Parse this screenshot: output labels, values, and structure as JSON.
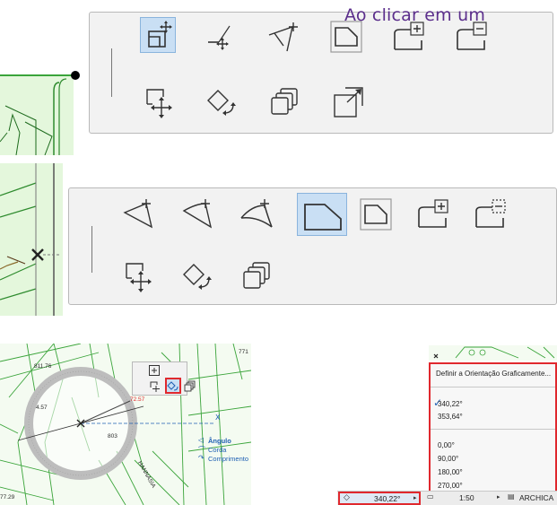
{
  "caption": "Ao clicar em um",
  "toolbar1": {
    "buttons": [
      {
        "name": "offset-edge-icon",
        "selected": true
      },
      {
        "name": "curve-edge-icon"
      },
      {
        "name": "fillet-vertex-icon"
      },
      {
        "name": "polygon-shape-icon"
      },
      {
        "name": "add-to-polygon-icon"
      },
      {
        "name": "subtract-from-polygon-icon"
      },
      {
        "name": "drag-icon"
      },
      {
        "name": "rotate-icon"
      },
      {
        "name": "multiply-icon"
      },
      {
        "name": "resize-icon"
      }
    ]
  },
  "toolbar2": {
    "buttons": [
      {
        "name": "arc-segment-icon"
      },
      {
        "name": "arc-tangent-icon"
      },
      {
        "name": "arc-curve-icon"
      },
      {
        "name": "polygon-shape-icon",
        "selected": true
      },
      {
        "name": "polygon-offset-icon"
      },
      {
        "name": "add-to-polygon-icon"
      },
      {
        "name": "subtract-from-polygon-icon"
      },
      {
        "name": "drag-icon"
      },
      {
        "name": "rotate-icon"
      },
      {
        "name": "multiply-icon"
      }
    ]
  },
  "map": {
    "labels": [
      "811.76",
      "4.57",
      "803",
      "72.57",
      "771",
      "HANNASIA",
      "77.29"
    ],
    "legend": [
      "Ângulo",
      "Corda",
      "Comprimento"
    ]
  },
  "orientation_menu": {
    "header": "Definir a Orientação Graficamente...",
    "checked_item": "340,22°",
    "other_recent": "353,64°",
    "presets": [
      "0,00°",
      "90,00°",
      "180,00°",
      "270,00°"
    ]
  },
  "status_bar": {
    "orientation_value": "340,22°",
    "scale": "1:50",
    "layer": "ARCHICA"
  },
  "colors": {
    "caption": "#5b2e8c",
    "highlight": "#e0282e",
    "selection": "#c9dff4",
    "map_fill": "#e4f7dc",
    "map_line": "#3aa43a"
  }
}
